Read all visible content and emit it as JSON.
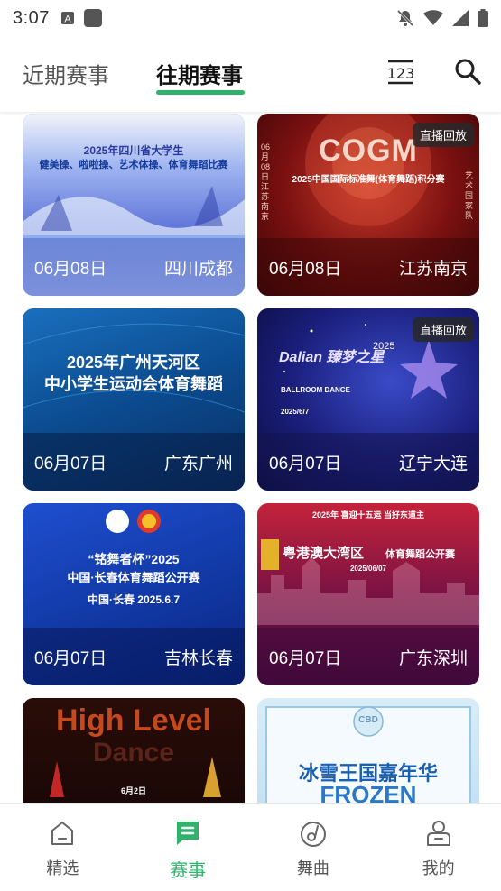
{
  "status_bar": {
    "time": "3:07",
    "icons": [
      "a-badge-icon",
      "square-notification-icon",
      "mute-bell-icon",
      "wifi-icon",
      "signal-icon",
      "battery-icon"
    ]
  },
  "header": {
    "tabs": [
      {
        "label": "近期赛事",
        "active": false
      },
      {
        "label": "往期赛事",
        "active": true
      }
    ],
    "actions": [
      "calendar-icon",
      "search-icon"
    ],
    "accent_color": "#2fb26a"
  },
  "cards": [
    {
      "date": "06月08日",
      "location": "四川成都",
      "replay": false,
      "poster_title": "2025年四川省大学生",
      "poster_subtitle": "健美操、啦啦操、艺术体操、体育舞蹈比赛"
    },
    {
      "date": "06月08日",
      "location": "江苏南京",
      "replay": true,
      "replay_label": "直播回放",
      "poster_title": "COGM",
      "poster_subtitle": "2025中国国际标准舞(体育舞蹈)积分赛",
      "poster_side_left": "06月08日 江苏·南京",
      "poster_side_right": "艺术国家队"
    },
    {
      "date": "06月07日",
      "location": "广东广州",
      "replay": false,
      "poster_title": "2025年广州天河区",
      "poster_subtitle": "中小学生运动会体育舞蹈"
    },
    {
      "date": "06月07日",
      "location": "辽宁大连",
      "replay": true,
      "replay_label": "直播回放",
      "poster_title": "Dalian 臻梦之星",
      "poster_subtitle": "BALLROOM DANCE",
      "poster_year": "2025",
      "poster_date": "2025/6/7"
    },
    {
      "date": "06月07日",
      "location": "吉林长春",
      "replay": false,
      "poster_title": "“铭舞者杯”2025",
      "poster_subtitle": "中国·长春体育舞蹈公开赛",
      "poster_date": "中国·长春 2025.6.7"
    },
    {
      "date": "06月07日",
      "location": "广东深圳",
      "replay": false,
      "poster_title": "粤港澳大湾区",
      "poster_subtitle": "体育舞蹈公开赛",
      "poster_top": "2025年 喜迎十五运 当好东道主",
      "poster_date": "2025/06/07"
    },
    {
      "date": "",
      "location": "",
      "replay": false,
      "poster_title": "High Level",
      "poster_subtitle": "Dance",
      "poster_date": "6月2日"
    },
    {
      "date": "",
      "location": "",
      "replay": false,
      "poster_title": "冰雪王国嘉年华",
      "poster_subtitle": "FROZEN",
      "poster_top": "CBD"
    }
  ],
  "bottom_nav": [
    {
      "label": "精选",
      "icon": "home-icon",
      "active": false
    },
    {
      "label": "赛事",
      "icon": "events-icon",
      "active": true
    },
    {
      "label": "舞曲",
      "icon": "music-icon",
      "active": false
    },
    {
      "label": "我的",
      "icon": "profile-icon",
      "active": false
    }
  ]
}
